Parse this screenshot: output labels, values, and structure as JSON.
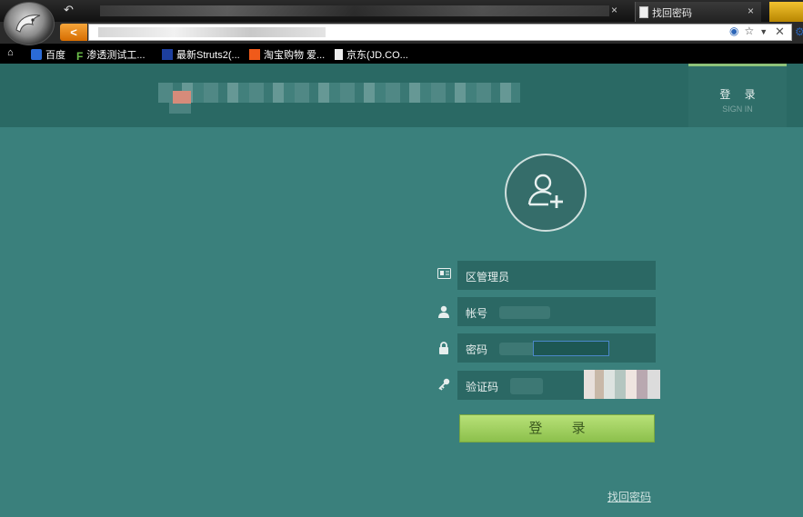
{
  "browser": {
    "tab_label": "找回密码",
    "bookmarks": [
      {
        "label": "百度",
        "icon": "baidu-icon"
      },
      {
        "label": "渗透测试工...",
        "icon": "f-logo-icon"
      },
      {
        "label": "最新Struts2(...",
        "icon": "struts-icon"
      },
      {
        "label": "淘宝购物 爱...",
        "icon": "taobao-icon"
      },
      {
        "label": "京东(JD.CO...",
        "icon": "document-icon"
      }
    ]
  },
  "header": {
    "signin_label": "登 录",
    "signin_sublabel": "SIGN IN"
  },
  "form": {
    "role_label": "区管理员",
    "account_label": "帐号",
    "password_label": "密码",
    "captcha_label": "验证码",
    "login_button": "登 录",
    "find_password": "找回密码"
  },
  "colors": {
    "background": "#3a807c",
    "header": "#2a6964",
    "field": "#2b6864",
    "login_button": "#9fd05e",
    "signin_accent": "#8ec27a"
  }
}
